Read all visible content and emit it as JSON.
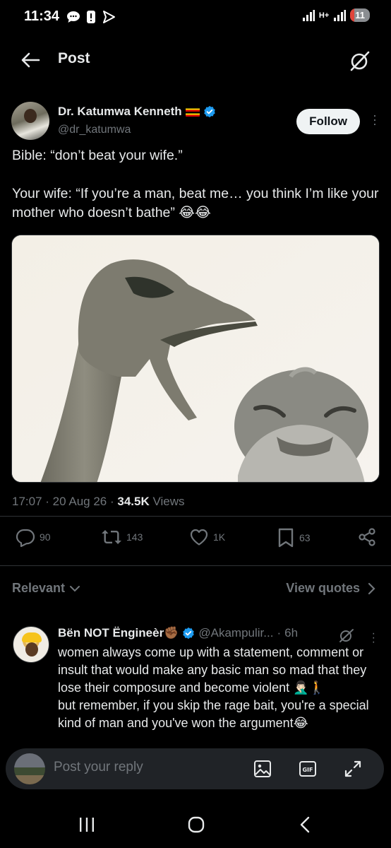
{
  "status_bar": {
    "time": "11:34",
    "network": "H+",
    "battery": "11"
  },
  "header": {
    "title": "Post"
  },
  "author": {
    "name": "Dr. Katumwa Kenneth",
    "handle": "@dr_katumwa",
    "follow_label": "Follow"
  },
  "tweet": {
    "text": "Bible: “don’t beat your wife.”\n\nYour wife: “If you’re a man, beat me… you think I’m like your mother who doesn’t bathe” 😂😂"
  },
  "meta": {
    "time": "17:07",
    "date": "20 Aug 26",
    "views_count": "34.5K",
    "views_label": "Views"
  },
  "actions": {
    "replies": "90",
    "reposts": "143",
    "likes": "1K",
    "bookmarks": "63"
  },
  "replies_section": {
    "sort_label": "Relevant",
    "view_quotes_label": "View quotes"
  },
  "reply": {
    "name": "Bën NOT Ëngineèr✊🏾",
    "handle": "@Akampulir...",
    "age": "6h",
    "text": "women always come up with a statement, comment or insult that would make any basic man so mad that they lose their composure and become violent 🤦🏻‍♂️🚶\nbut remember, if you skip the rage bait, you're a special kind of man and you've won the argument😂"
  },
  "compose": {
    "placeholder": "Post your reply"
  },
  "colors": {
    "background": "#000000",
    "text": "#e7e9ea",
    "muted": "#71767b",
    "verified": "#1d9bf0",
    "divider": "#2f3336"
  }
}
